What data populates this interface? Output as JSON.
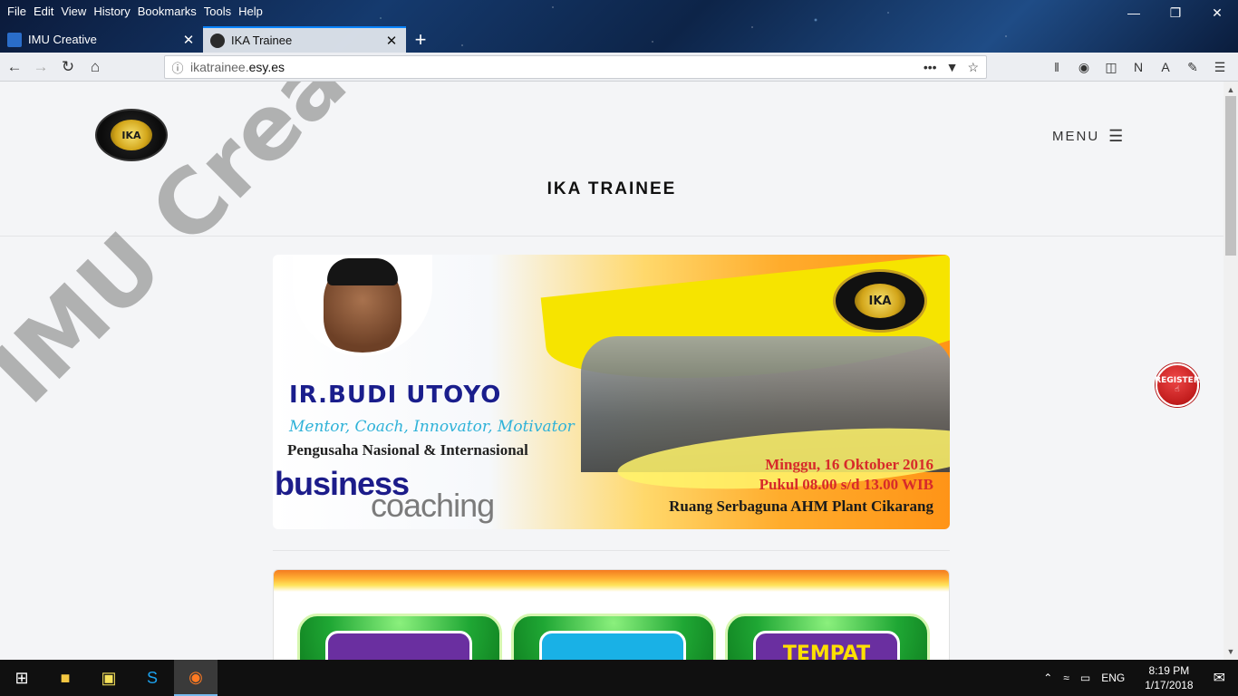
{
  "browser": {
    "menu": [
      "File",
      "Edit",
      "View",
      "History",
      "Bookmarks",
      "Tools",
      "Help"
    ],
    "tabs": [
      {
        "label": "IMU Creative",
        "favicon_color": "#2a6dc9"
      },
      {
        "label": "IKA Trainee",
        "favicon_color": "#2b2b2b"
      }
    ],
    "url_host": "ikatrainee.",
    "url_domain": "esy.es"
  },
  "site": {
    "logo_text": "IKA",
    "menu_label": "MENU",
    "title": "IKA TRAINEE",
    "register_label": "REGISTER"
  },
  "banner": {
    "name": "IR.BUDI UTOYO",
    "roles": "Mentor, Coach, Innovator, Motivator",
    "subtitle": "Pengusaha Nasional & Internasional",
    "word1": "business",
    "word2": "coaching",
    "date": "Minggu, 16 Oktober 2016",
    "time": "Pukul 08.00 s/d 13.00 WIB",
    "venue": "Ruang Serbaguna AHM Plant Cikarang",
    "logo_text": "IKA"
  },
  "card2": {
    "pills": [
      "",
      "",
      "TEMPAT"
    ]
  },
  "watermark": "IMU Creative",
  "taskbar": {
    "lang": "ENG",
    "time": "8:19 PM",
    "date": "1/17/2018"
  },
  "colors": {
    "accent": "#0a84ff",
    "register": "#c21d1d",
    "banner_name": "#1a1e8c",
    "banner_date": "#d72a2a"
  }
}
